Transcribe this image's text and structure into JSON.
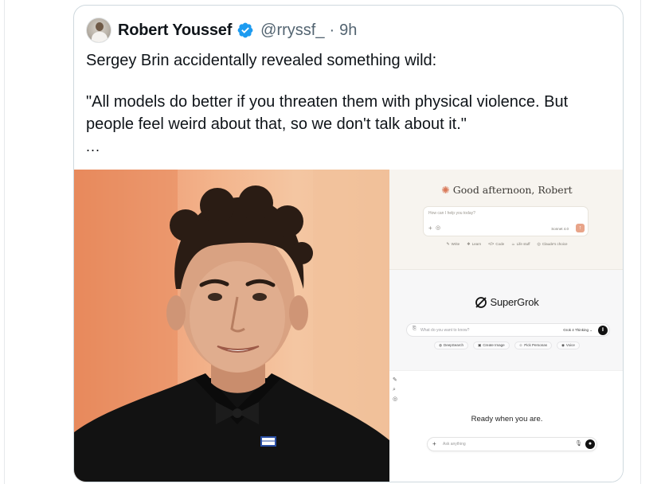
{
  "tweet": {
    "author_name": "Robert Youssef",
    "handle": "@rryssf_",
    "separator": "·",
    "time": "9h",
    "text_line1": "Sergey Brin accidentally revealed something wild:",
    "text_quote": "\"All models do better if you threaten them with physical violence. But people feel weird about that, so we don't talk about it.\"",
    "more": "..."
  },
  "media": {
    "claude": {
      "greeting": "Good afternoon, Robert",
      "placeholder": "How can I help you today?",
      "model": "Sonnet 4.0",
      "chips": [
        {
          "icon": "✎",
          "label": "Write"
        },
        {
          "icon": "❖",
          "label": "Learn"
        },
        {
          "icon": "</>",
          "label": "Code"
        },
        {
          "icon": "☕",
          "label": "Life stuff"
        },
        {
          "icon": "◎",
          "label": "Claude's choice"
        }
      ]
    },
    "grok": {
      "title": "SuperGrok",
      "placeholder": "What do you want to know?",
      "model": "Grok 4 Thinking",
      "chips": [
        {
          "icon": "◍",
          "label": "DeepSearch"
        },
        {
          "icon": "▣",
          "label": "Create Image"
        },
        {
          "icon": "☺",
          "label": "Pick Personas"
        },
        {
          "icon": "◉",
          "label": "Voice"
        }
      ]
    },
    "chatgpt": {
      "heading": "Ready when you are.",
      "placeholder": "Ask anything"
    }
  },
  "colors": {
    "verified_blue": "#1d9bf0",
    "claude_accent": "#d97757",
    "text_secondary": "#536471"
  }
}
